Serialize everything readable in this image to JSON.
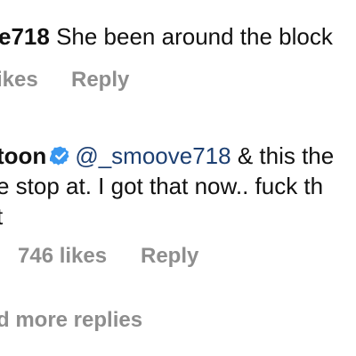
{
  "comment1": {
    "username": "e718",
    "text": " She been around the block",
    "likes": "ikes",
    "reply": "Reply"
  },
  "comment2": {
    "username": "toon",
    "mention": "@_smoove718",
    "text_line1": " & this the",
    "text_line2": "e stop at. I got that now.. fuck th",
    "text_line3": "t",
    "likes": "746 likes",
    "reply": "Reply"
  },
  "more_replies": "d more replies",
  "verified_icon": "verified-badge-icon",
  "colors": {
    "mention": "#1c3f72",
    "meta": "#8e8e8e",
    "verified": "#3897f0"
  }
}
